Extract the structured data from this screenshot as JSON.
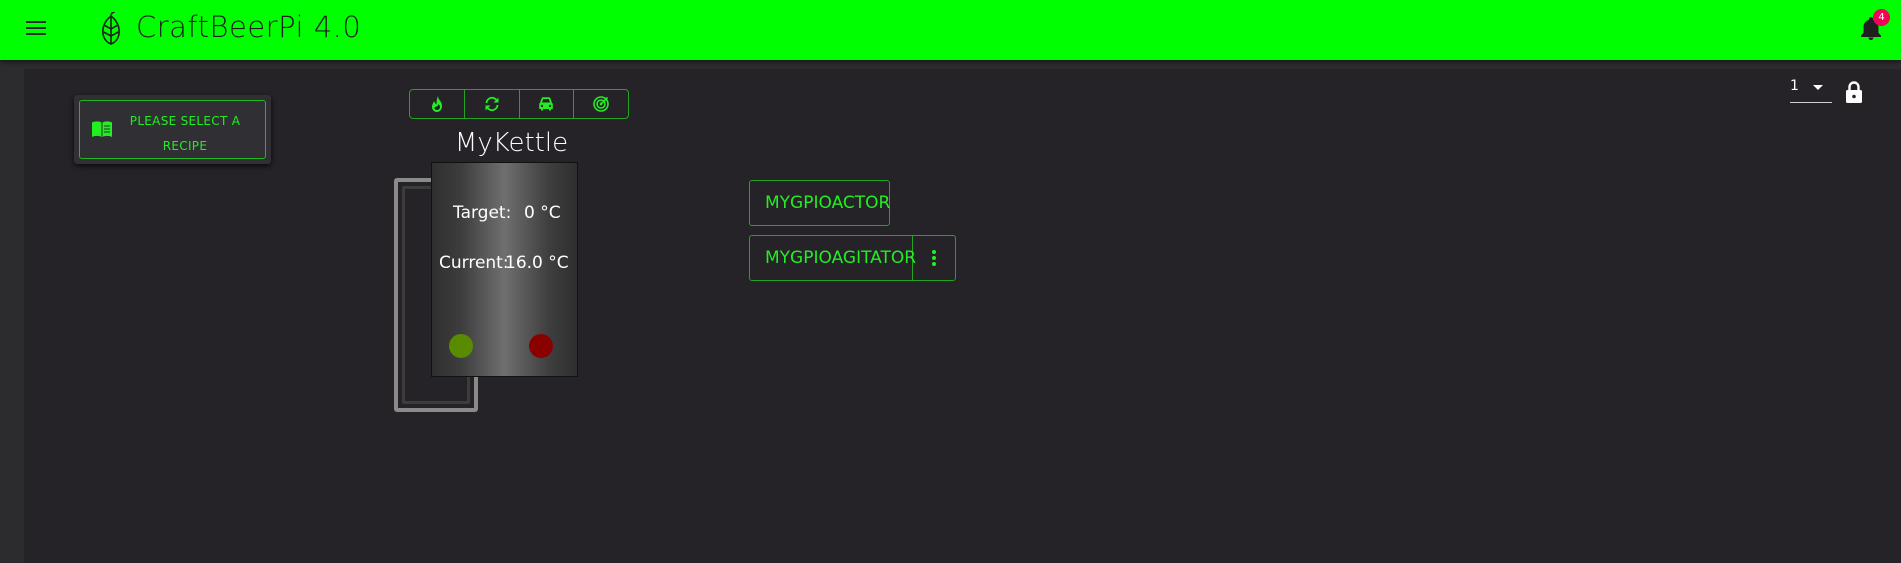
{
  "appbar": {
    "title": "CraftBeerPi 4.0",
    "notification_count": "4",
    "background_color": "#00ff00"
  },
  "recipe": {
    "label_line1": "PLEASE SELECT A",
    "label_line2": "RECIPE"
  },
  "kettle": {
    "name": "MyKettle",
    "target_label": "Target:",
    "target_value": "0 °C",
    "current_label": "Current:",
    "current_value": "16.0 °C",
    "heater_led_color": "#5a8a00",
    "status_led_color": "#8a0000"
  },
  "kettle_toolbar": {
    "icons": [
      "flame-icon",
      "sync-icon",
      "car-icon",
      "radar-icon"
    ]
  },
  "actors": {
    "actor1": "MYGPIOACTOR",
    "actor2": "MYGPIOAGITATOR"
  },
  "dashboard": {
    "selected_page": "1"
  },
  "colors": {
    "accent": "#22ee22",
    "border_accent": "#20a520",
    "dashboard_bg": "#252328"
  }
}
